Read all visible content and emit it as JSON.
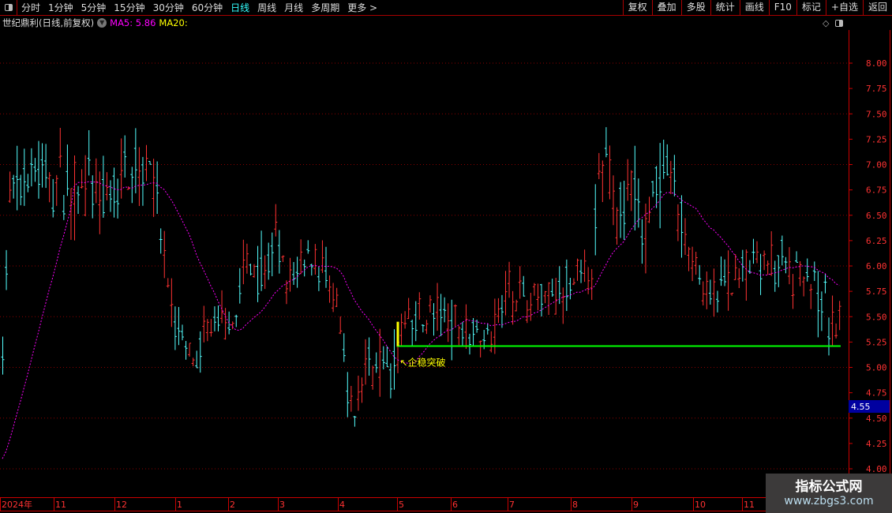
{
  "toolbar": {
    "periods": [
      "分时",
      "1分钟",
      "5分钟",
      "15分钟",
      "30分钟",
      "60分钟",
      "日线",
      "周线",
      "月线",
      "多周期",
      "更多 >"
    ],
    "active": "日线",
    "right": [
      "复权",
      "叠加",
      "多股",
      "统计",
      "画线",
      "F10",
      "标记",
      "+自选",
      "返回"
    ]
  },
  "title": {
    "stock": "世纪鼎利(日线,前复权)",
    "ma5_label": "MA5: 5.86",
    "ma20_label": "MA20:"
  },
  "annotation": {
    "text": "↖企稳突破"
  },
  "current_price_label": "4.55",
  "watermark": {
    "line1": "指标公式网",
    "line2": "www.zbgs3.com"
  },
  "colors": {
    "up": "#ff3232",
    "down": "#54ffff",
    "ma5": "#ff00ff",
    "grid": "#8b0000",
    "axis": "#ff3232",
    "support": "#00ff00",
    "marker": "#ffff00",
    "price_box": "#0000a0"
  },
  "chart_data": {
    "type": "ohlc",
    "ylim": [
      4.0,
      8.1
    ],
    "yticks": [
      "8.00",
      "7.75",
      "7.50",
      "7.25",
      "7.00",
      "6.75",
      "6.50",
      "6.25",
      "6.00",
      "5.75",
      "5.50",
      "5.25",
      "5.00",
      "4.75",
      "4.50",
      "4.25",
      "4.00"
    ],
    "months": [
      "2024年",
      "11",
      "12",
      "1",
      "2",
      "3",
      "4",
      "5",
      "6",
      "7",
      "8",
      "9",
      "10",
      "11"
    ],
    "bar_count": 234,
    "price_path": [
      [
        0,
        5.3
      ],
      [
        2,
        6.6
      ],
      [
        9,
        7.0
      ],
      [
        13,
        6.8
      ],
      [
        22,
        6.8
      ],
      [
        29,
        6.6
      ],
      [
        35,
        7.0
      ],
      [
        40,
        7.1
      ],
      [
        43,
        6.6
      ],
      [
        46,
        5.7
      ],
      [
        51,
        5.1
      ],
      [
        54,
        5.0
      ],
      [
        57,
        5.4
      ],
      [
        62,
        5.3
      ],
      [
        65,
        5.6
      ],
      [
        68,
        6.0
      ],
      [
        73,
        6.0
      ],
      [
        76,
        6.2
      ],
      [
        79,
        5.8
      ],
      [
        85,
        6.1
      ],
      [
        87,
        6.1
      ],
      [
        90,
        5.8
      ],
      [
        93,
        5.5
      ],
      [
        97,
        4.5
      ],
      [
        98,
        4.6
      ],
      [
        101,
        5.05
      ],
      [
        108,
        5.0
      ],
      [
        110,
        5.1
      ],
      [
        112,
        5.45
      ],
      [
        119,
        5.5
      ],
      [
        127,
        5.45
      ],
      [
        136,
        5.3
      ],
      [
        141,
        5.8
      ],
      [
        145,
        5.65
      ],
      [
        154,
        5.7
      ],
      [
        160,
        5.85
      ],
      [
        164,
        5.9
      ],
      [
        166,
        6.8
      ],
      [
        168,
        7.1
      ],
      [
        171,
        6.5
      ],
      [
        176,
        6.9
      ],
      [
        178,
        6.2
      ],
      [
        181,
        6.8
      ],
      [
        186,
        6.85
      ],
      [
        189,
        6.4
      ],
      [
        193,
        6.0
      ],
      [
        196,
        5.65
      ],
      [
        200,
        5.75
      ],
      [
        207,
        5.95
      ],
      [
        213,
        6.0
      ],
      [
        216,
        6.1
      ],
      [
        220,
        5.9
      ],
      [
        224,
        5.95
      ],
      [
        229,
        5.6
      ],
      [
        232,
        5.3
      ],
      [
        233,
        5.45
      ]
    ],
    "support_level": 5.21,
    "breakout_bar_index": 110,
    "ma_period": 20
  }
}
